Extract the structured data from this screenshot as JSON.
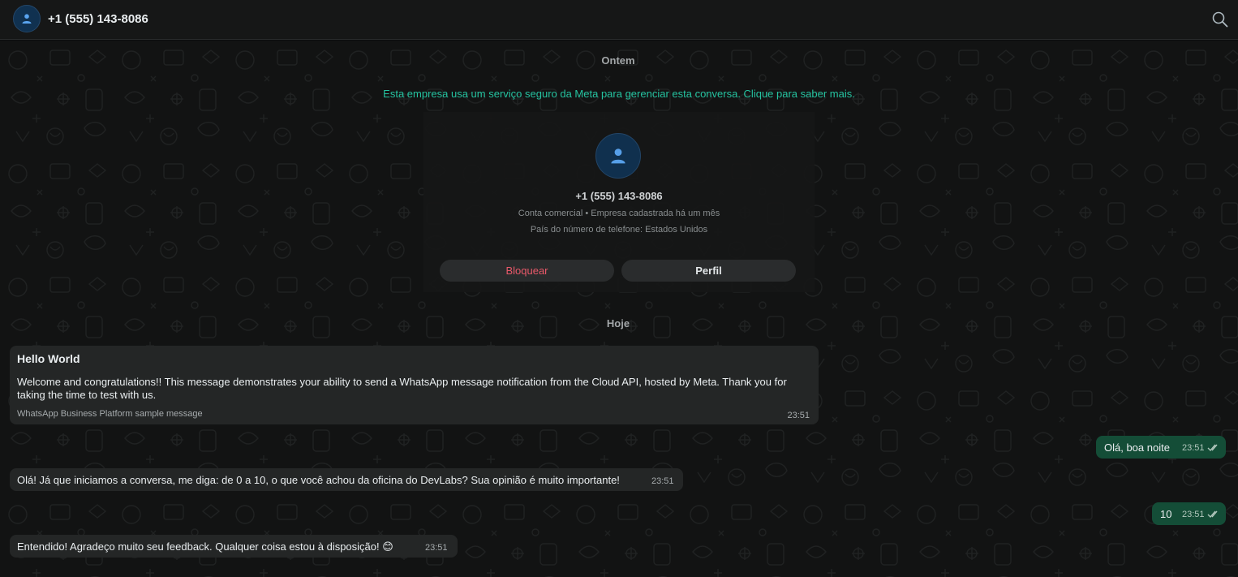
{
  "header": {
    "contact_name": "+1 (555) 143-8086",
    "avatar_icon": "person-icon",
    "search_icon": "search-icon"
  },
  "chat": {
    "date_yesterday": "Ontem",
    "meta_notice": "Esta empresa usa um serviço seguro da Meta para gerenciar esta conversa. Clique para saber mais.",
    "contact_card": {
      "name": "+1 (555) 143-8086",
      "line1": "Conta comercial • Empresa cadastrada há um mês",
      "line2": "País do número de telefone: Estados Unidos",
      "block_label": "Bloquear",
      "profile_label": "Perfil"
    },
    "date_today": "Hoje",
    "messages": [
      {
        "direction": "in",
        "title": "Hello World",
        "text": "Welcome and congratulations!! This message demonstrates your ability to send a WhatsApp message notification from the Cloud API, hosted by Meta. Thank you for taking the time to test with us.",
        "footer": "WhatsApp Business Platform sample message",
        "time": "23:51"
      },
      {
        "direction": "out",
        "text": "Olá, boa noite",
        "time": "23:51",
        "status": "read-ticks-icon"
      },
      {
        "direction": "in",
        "text": "Olá! Já que iniciamos a conversa, me diga: de 0 a 10, o que você achou da oficina do DevLabs? Sua opinião é muito importante!",
        "time": "23:51"
      },
      {
        "direction": "out",
        "text": "10",
        "time": "23:51",
        "status": "read-ticks-icon"
      },
      {
        "direction": "in",
        "text": "Entendido! Agradeço muito seu feedback. Qualquer coisa estou à disposição! 😊",
        "time": "23:51"
      }
    ]
  },
  "colors": {
    "header_bg": "#161717",
    "chat_bg": "#121313",
    "incoming_bubble": "#242626",
    "outgoing_bubble": "#144d37",
    "meta_notice": "#25c3a0",
    "block_text": "#f15c6d",
    "avatar_bg": "#103150"
  }
}
